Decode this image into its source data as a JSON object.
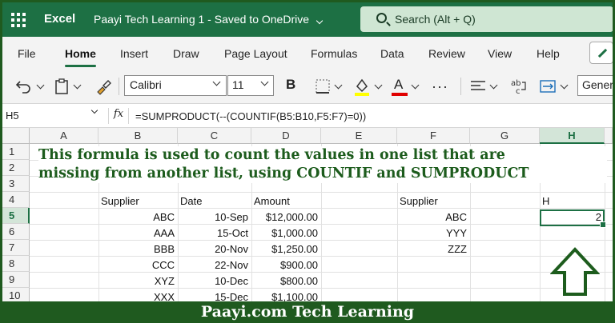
{
  "titlebar": {
    "app_name": "Excel",
    "doc_title": "Paayi Tech Learning 1  -  Saved to OneDrive",
    "search_placeholder": "Search (Alt + Q)"
  },
  "ribbon": {
    "tabs": [
      "File",
      "Home",
      "Insert",
      "Draw",
      "Page Layout",
      "Formulas",
      "Data",
      "Review",
      "View",
      "Help"
    ],
    "active_tab": "Home",
    "accent_color": "#1d7044"
  },
  "toolbar": {
    "font_name": "Calibri",
    "font_size": "11",
    "bold_label": "B",
    "font_color_label": "A",
    "number_format": "General",
    "fill_color": "#ffff00",
    "font_color": "#e00000"
  },
  "formula_bar": {
    "name_box": "H5",
    "fx_label": "fx",
    "formula": "=SUMPRODUCT(--(COUNTIF(B5:B10,F5:F7)=0))"
  },
  "sheet": {
    "columns": [
      "A",
      "B",
      "C",
      "D",
      "E",
      "F",
      "G",
      "H"
    ],
    "selected_column": "H",
    "rows": [
      "1",
      "2",
      "3",
      "4",
      "5",
      "6",
      "7",
      "8",
      "9",
      "10"
    ],
    "selected_row": "5",
    "headers": {
      "supplier": "Supplier",
      "date": "Date",
      "amount": "Amount",
      "supplier2": "Supplier",
      "h": "H"
    },
    "data": [
      {
        "supplier": "ABC",
        "date": "10-Sep",
        "amount": "$12,000.00"
      },
      {
        "supplier": "AAA",
        "date": "15-Oct",
        "amount": "$1,000.00"
      },
      {
        "supplier": "BBB",
        "date": "20-Nov",
        "amount": "$1,250.00"
      },
      {
        "supplier": "CCC",
        "date": "22-Nov",
        "amount": "$900.00"
      },
      {
        "supplier": "XYZ",
        "date": "10-Dec",
        "amount": "$800.00"
      },
      {
        "supplier": "XXX",
        "date": "15-Dec",
        "amount": "$1,100.00"
      }
    ],
    "list2": [
      "ABC",
      "YYY",
      "ZZZ"
    ],
    "result": "2"
  },
  "overlay": {
    "line1": "This formula is used to count the values in one list that are",
    "line2": "missing from another list, using COUNTIF and SUMPRODUCT"
  },
  "banner": "Paayi.com Tech Learning"
}
